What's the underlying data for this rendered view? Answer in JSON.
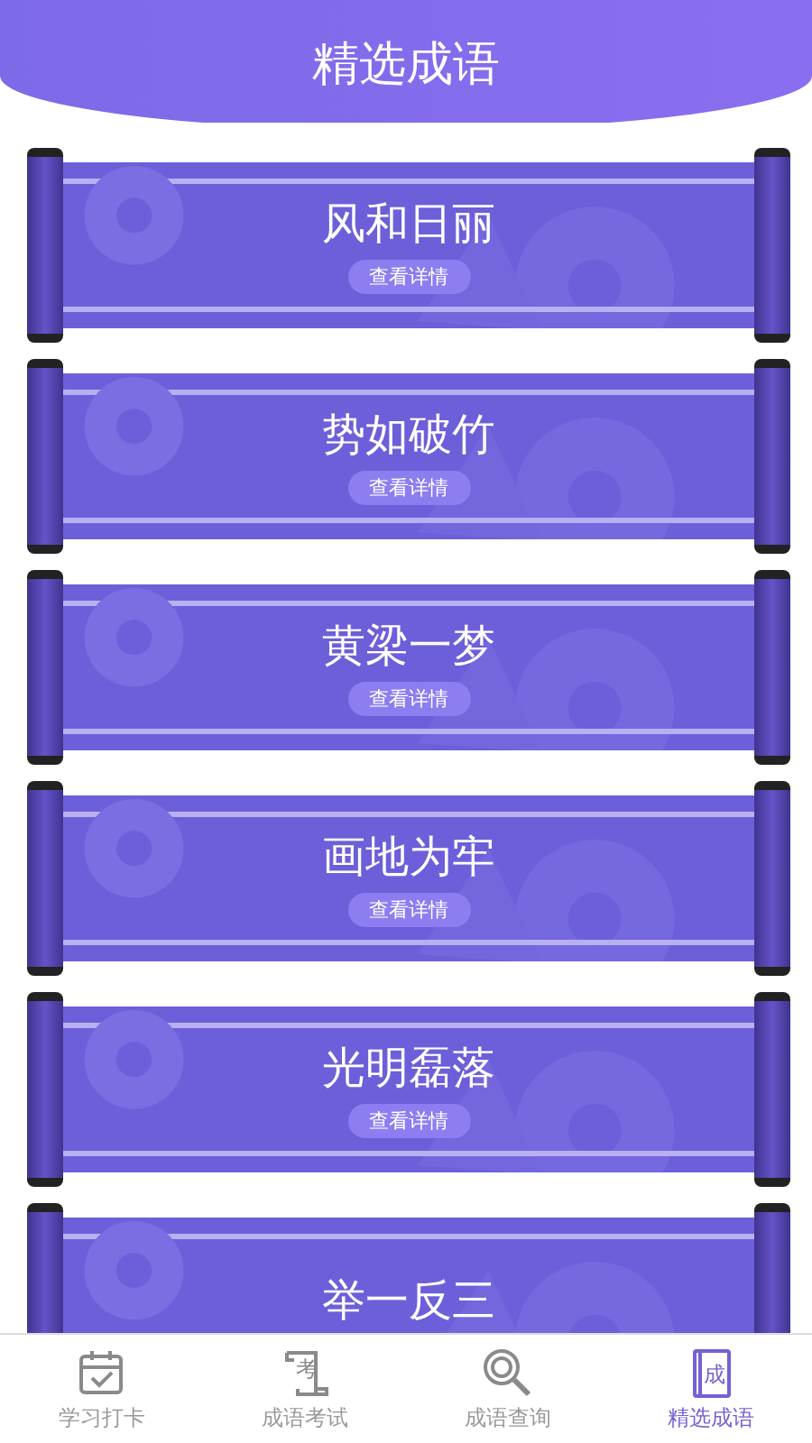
{
  "header": {
    "title": "精选成语"
  },
  "idioms": [
    {
      "title": "风和日丽",
      "button": "查看详情"
    },
    {
      "title": "势如破竹",
      "button": "查看详情"
    },
    {
      "title": "黄梁一梦",
      "button": "查看详情"
    },
    {
      "title": "画地为牢",
      "button": "查看详情"
    },
    {
      "title": "光明磊落",
      "button": "查看详情"
    },
    {
      "title": "举一反三"
    }
  ],
  "tabs": [
    {
      "label": "学习打卡",
      "kind": "calendar",
      "selected": false
    },
    {
      "label": "成语考试",
      "kind": "scroll",
      "icon_text": "考",
      "selected": false
    },
    {
      "label": "成语查询",
      "kind": "search",
      "selected": false
    },
    {
      "label": "精选成语",
      "kind": "book",
      "icon_text": "成",
      "selected": true
    }
  ]
}
